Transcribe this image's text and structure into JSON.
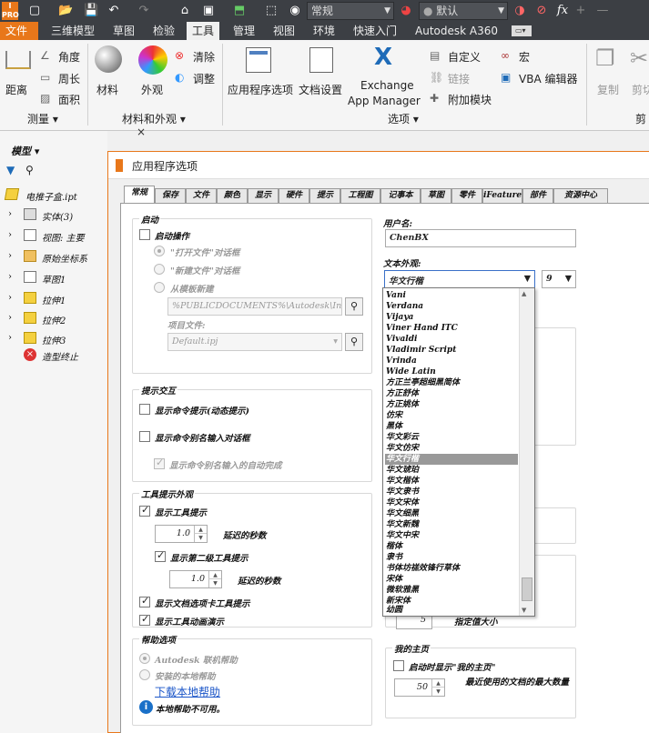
{
  "qat": {
    "style_combo": "常规",
    "material_combo": "默认",
    "fx": "fx"
  },
  "tabs": [
    "文件",
    "三维模型",
    "草图",
    "检验",
    "工具",
    "管理",
    "视图",
    "环境",
    "快速入门",
    "Autodesk A360"
  ],
  "ribbon": {
    "measure": {
      "distance": "距离",
      "angle": "角度",
      "perimeter": "周长",
      "area": "面积",
      "title": "测量"
    },
    "material": {
      "material": "材料",
      "appearance": "外观",
      "clear": "清除",
      "adjust": "调整",
      "title": "材料和外观"
    },
    "options": {
      "app_options": "应用程序选项",
      "doc_settings": "文档设置",
      "exchange_line1": "Exchange",
      "exchange_line2": "App Manager",
      "customize": "自定义",
      "links": "链接",
      "addins": "附加模块",
      "title": "选项"
    },
    "macro": {
      "macro": "宏",
      "vba": "VBA 编辑器"
    },
    "clipboard": {
      "copy": "复制",
      "cut": "剪切",
      "title": "剪"
    }
  },
  "browser": {
    "title": "模型",
    "items": [
      {
        "label": "电推子盒.ipt",
        "icon": "part-icon"
      },
      {
        "label": "实体(3)",
        "icon": "solid-bodies-icon"
      },
      {
        "label": "视图: 主要",
        "icon": "view-icon"
      },
      {
        "label": "原始坐标系",
        "icon": "folder-icon"
      },
      {
        "label": "草图1",
        "icon": "sketch-icon"
      },
      {
        "label": "拉伸1",
        "icon": "extrude-icon"
      },
      {
        "label": "拉伸2",
        "icon": "extrude-icon"
      },
      {
        "label": "拉伸3",
        "icon": "extrude-icon"
      },
      {
        "label": "造型终止",
        "icon": "end-of-part-icon"
      }
    ]
  },
  "dialog": {
    "title": "应用程序选项",
    "tabs": [
      "常规",
      "保存",
      "文件",
      "颜色",
      "显示",
      "硬件",
      "提示",
      "工程图",
      "记事本",
      "草图",
      "零件",
      "iFeature",
      "部件",
      "资源中心"
    ],
    "startup": {
      "title": "启动",
      "startup_action": "启动操作",
      "open_file": "\"打开文件\"对话框",
      "new_file": "\"新建文件\"对话框",
      "from_template": "从模板新建",
      "template_path": "%PUBLICDOCUMENTS%\\Autodesk\\Inve",
      "project_file_label": "项目文件:",
      "project_file": "Default.ipj"
    },
    "prompts": {
      "title": "提示交互",
      "show_cmd_prompts": "显示命令提示(动态提示)",
      "show_alias_dialog": "显示命令别名输入对话框",
      "show_autocomplete": "显示命令别名输入的自动完成"
    },
    "tooltip": {
      "title": "工具提示外观",
      "show_tooltips": "显示工具提示",
      "delay1": "1.0",
      "delay_label": "延迟的秒数",
      "show_second": "显示第二级工具提示",
      "delay2": "1.0",
      "delay2_label": "延迟的秒数",
      "show_doc_tab": "显示文档选项卡工具提示",
      "show_animation": "显示工具动画演示"
    },
    "help": {
      "title": "帮助选项",
      "online": "Autodesk 联机帮助",
      "local": "安装的本地帮助",
      "download": "下载本地帮助",
      "unavailable": "本地帮助不可用。"
    },
    "user": {
      "label": "用户名:",
      "name": "ChenBX"
    },
    "text_appearance": {
      "label": "文本外观:",
      "font": "华文行楷",
      "size": "9"
    },
    "home": {
      "title": "我的主页",
      "show_home": "启动时显示\"我的主页\"",
      "recent_count": "50",
      "recent_label": "最近使用的文档的最大数量",
      "obscured_value": "5",
      "obscured_label": "指定值大小"
    },
    "font_list": [
      "Vani",
      "Verdana",
      "Vijaya",
      "Viner Hand ITC",
      "Vivaldi",
      "Vladimir Script",
      "Vrinda",
      "Wide Latin",
      "方正兰亭超细黑简体",
      "方正舒体",
      "方正姚体",
      "仿宋",
      "黑体",
      "华文彩云",
      "华文仿宋",
      "华文行楷",
      "华文琥珀",
      "华文楷体",
      "华文隶书",
      "华文宋体",
      "华文细黑",
      "华文新魏",
      "华文中宋",
      "楷体",
      "隶书",
      "书体坊禚效锋行草体",
      "宋体",
      "微软雅黑",
      "新宋体",
      "幼圆"
    ],
    "font_selected": "华文行楷"
  },
  "colors": {
    "accent": "#e8771a",
    "bar": "#3c3f44",
    "link": "#1a55c8"
  }
}
